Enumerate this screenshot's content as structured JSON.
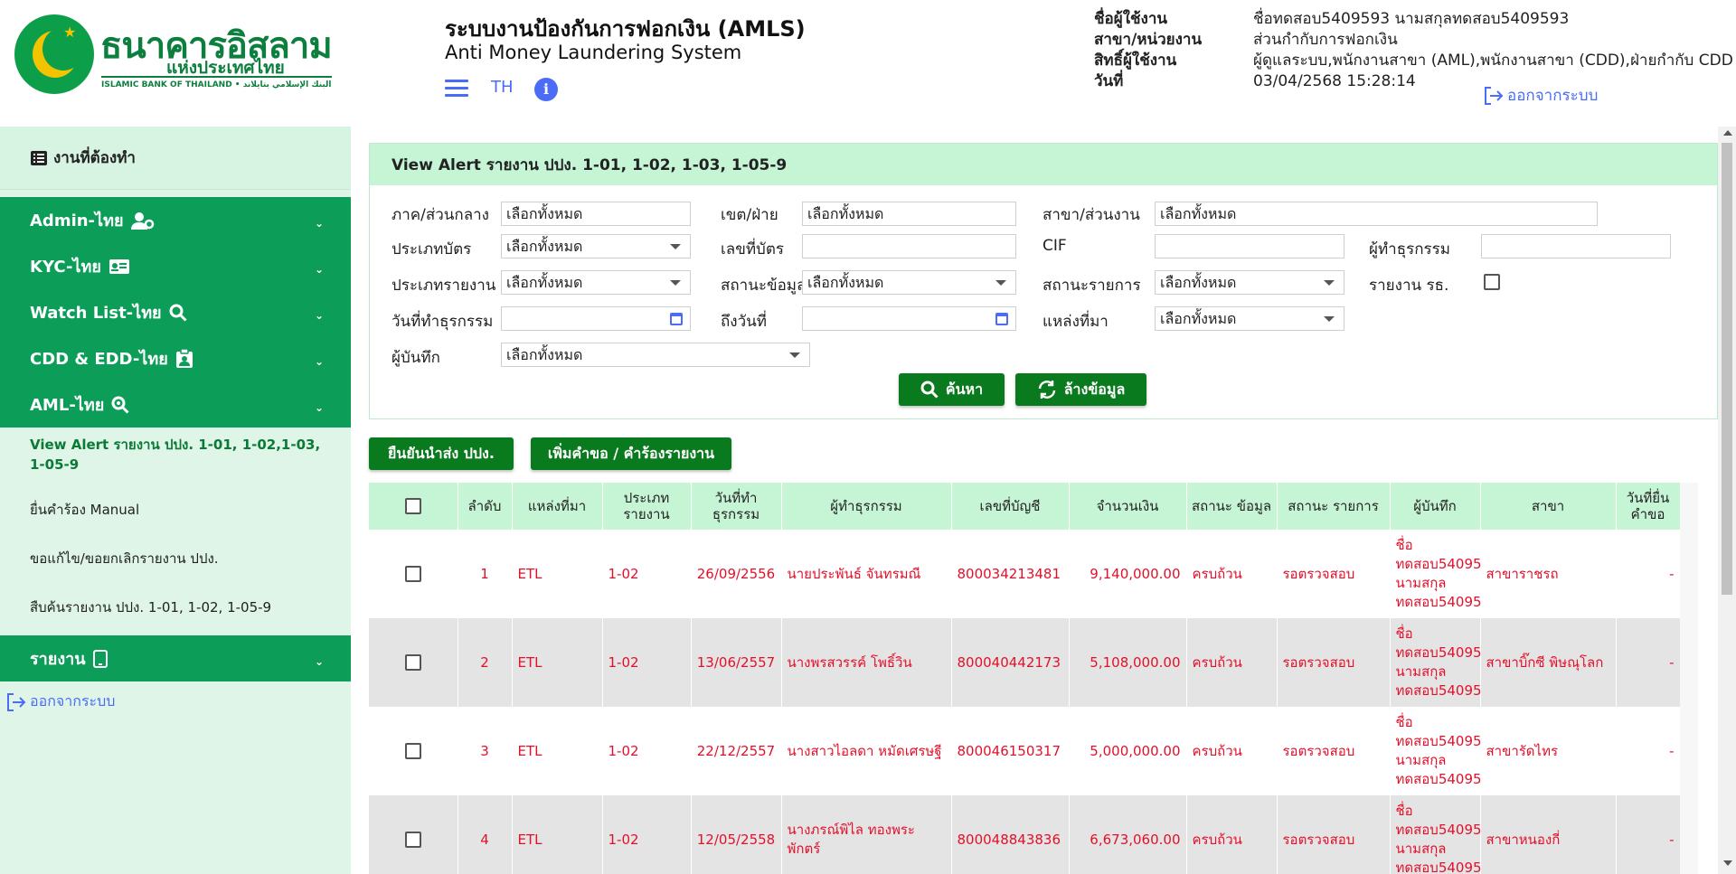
{
  "logo": {
    "th_name": "ธนาคารอิสลาม",
    "th_name2": "แห่งประเทศไทย",
    "en_name": "ISLAMIC BANK OF THAILAND • البنك الإسلامي بتايلاند"
  },
  "header": {
    "title": "ระบบงานป้องกันการฟอกเงิน (AMLS)",
    "subtitle": "Anti Money Laundering System",
    "lang": "TH",
    "info": "i",
    "user_labels": [
      "ชื่อผู้ใช้งาน",
      "สาขา/หน่วยงาน",
      "สิทธิ์ผู้ใช้งาน",
      "วันที่"
    ],
    "user_values": [
      "ชื่อทดสอบ5409593 นามสกุลทดสอบ5409593",
      "ส่วนกำกับการฟอกเงิน",
      "ผู้ดูแลระบบ,พนักงานสาขา (AML),พนักงานสาขา (CDD),ฝ่ายกำกับ CDD",
      "03/04/2568 15:28:14"
    ],
    "logout": "ออกจากระบบ"
  },
  "sidebar": {
    "todo": "งานที่ต้องทำ",
    "groups": [
      "Admin-ไทย",
      "KYC-ไทย",
      "Watch List-ไทย",
      "CDD & EDD-ไทย",
      "AML-ไทย"
    ],
    "aml_items": [
      "View Alert รายงาน ปปง. 1-01, 1-02,1-03, 1-05-9",
      "ยื่นคำร้อง Manual",
      "ขอแก้ไข/ขอยกเลิกรายงาน ปปง.",
      "สืบค้นรายงาน ปปง. 1-01, 1-02, 1-05-9"
    ],
    "report_group": "รายงาน",
    "logout": "ออกจากระบบ"
  },
  "panel": {
    "title": "View Alert รายงาน ปปง. 1-01, 1-02, 1-03, 1-05-9",
    "labels": {
      "region": "ภาค/ส่วนกลาง",
      "zone": "เขต/ฝ่าย",
      "branch": "สาขา/ส่วนงาน",
      "card_type": "ประเภทบัตร",
      "card_no": "เลขที่บัตร",
      "cif": "CIF",
      "trans_person": "ผู้ทำธุรกรรม",
      "report_type": "ประเภทรายงาน",
      "data_status": "สถานะข้อมูล",
      "item_status": "สถานะรายการ",
      "report_rr": "รายงาน รธ.",
      "trans_date": "วันที่ทำธุรกรรม",
      "to_date": "ถึงวันที่",
      "source": "แหล่งที่มา",
      "recorder": "ผู้บันทึก"
    },
    "select_all": "เลือกทั้งหมด",
    "search_btn": "ค้นหา",
    "clear_btn": "ล้างข้อมูล"
  },
  "actions": {
    "confirm": "ยืนยันนำส่ง ปปง.",
    "add_request": "เพิ่มคำขอ / คำร้องรายงาน"
  },
  "table": {
    "headers": [
      "",
      "ลำดับ",
      "แหล่งที่มา",
      "ประเภท รายงาน",
      "วันที่ทำ ธุรกรรม",
      "ผู้ทำธุรกรรม",
      "เลขที่บัญชี",
      "จำนวนเงิน",
      "สถานะ ข้อมูล",
      "สถานะ รายการ",
      "ผู้บันทึก",
      "สาขา",
      "วันที่ยื่น คำขอ"
    ],
    "rows": [
      [
        "1",
        "ETL",
        "1-02",
        "26/09/2556",
        "นายประพันธ์ จันทรมณี",
        "800034213481",
        "9,140,000.00",
        "ครบถ้วน",
        "รอตรวจสอบ",
        "ชื่อ ทดสอบ54095 นามสกุล ทดสอบ54095",
        "สาขาราชรถ",
        "-"
      ],
      [
        "2",
        "ETL",
        "1-02",
        "13/06/2557",
        "นางพรสวรรค์ โพธิ์วิน",
        "800040442173",
        "5,108,000.00",
        "ครบถ้วน",
        "รอตรวจสอบ",
        "ชื่อ ทดสอบ54095 นามสกุล ทดสอบ54095",
        "สาขาบิ๊กซี พิษณุโลก",
        "-"
      ],
      [
        "3",
        "ETL",
        "1-02",
        "22/12/2557",
        "นางสาวไอลดา หมัดเศรษฐี",
        "800046150317",
        "5,000,000.00",
        "ครบถ้วน",
        "รอตรวจสอบ",
        "ชื่อ ทดสอบ54095 นามสกุล ทดสอบ54095",
        "สาขารัดไทร",
        "-"
      ],
      [
        "4",
        "ETL",
        "1-02",
        "12/05/2558",
        "นางภรณ์พิไล ทองพระพักตร์",
        "800048843836",
        "6,673,060.00",
        "ครบถ้วน",
        "รอตรวจสอบ",
        "ชื่อ ทดสอบ54095 นามสกุล ทดสอบ54095",
        "สาขาหนองกี่",
        "-"
      ]
    ]
  },
  "colors": {
    "brand_green": "#0c9e58",
    "button_green": "#0a7a1e",
    "header_mint": "#c6f5d5",
    "row_text_red": "#e3102a",
    "link_blue": "#4a6cf7"
  }
}
